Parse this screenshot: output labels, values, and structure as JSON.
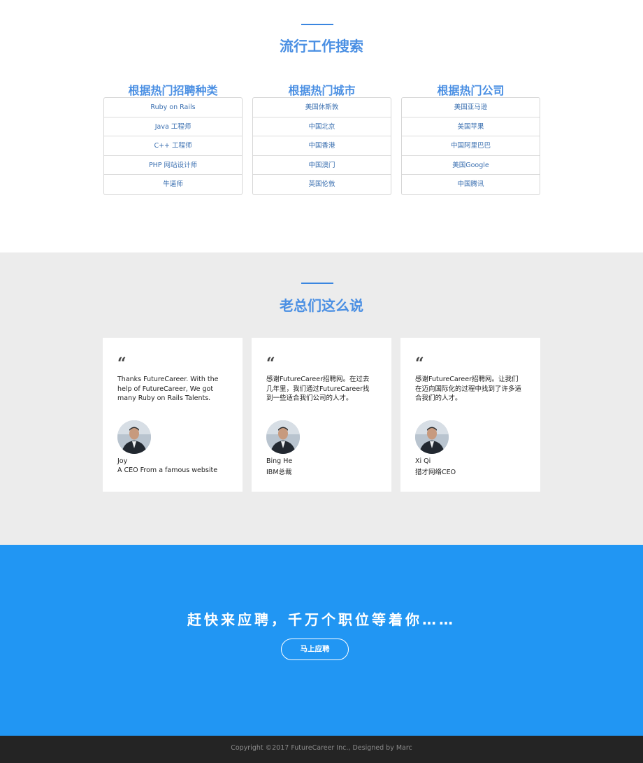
{
  "popular": {
    "title": "流行工作搜索",
    "columns": [
      {
        "title": "根据热门招聘种类",
        "items": [
          "Ruby on Rails",
          "Java 工程师",
          "C++ 工程师",
          "PHP 网站设计师",
          "牛逼师"
        ]
      },
      {
        "title": "根据热门城市",
        "items": [
          "美国休斯敦",
          "中国北京",
          "中国香港",
          "中国澳门",
          "英国伦敦"
        ]
      },
      {
        "title": "根据热门公司",
        "items": [
          "美国亚马逊",
          "美国苹果",
          "中国阿里巴巴",
          "美国Google",
          "中国腾讯"
        ]
      }
    ]
  },
  "ceo": {
    "title": "老总们这么说",
    "quote_glyph": "“",
    "cards": [
      {
        "text": "Thanks FutureCareer. With the help of FutureCareer, We got many Ruby on Rails Talents.",
        "name": "Joy",
        "role": "A CEO From a famous website"
      },
      {
        "text": "感谢FutureCareer招聘网。在过去几年里，我们通过FutureCareer找到一些适合我们公司的人才。",
        "name": "Bing He",
        "role": "IBM总裁"
      },
      {
        "text": "感谢FutureCareer招聘网。让我们在迈向国际化的过程中找到了许多适合我们的人才。",
        "name": "Xi Qi",
        "role": "猎才网络CEO"
      }
    ]
  },
  "cta": {
    "headline": "赶快来应聘，千万个职位等着你……",
    "button_label": "马上应聘"
  },
  "footer": {
    "copyright": "Copyright ©2017 FutureCareer Inc., Designed by Marc"
  },
  "colors": {
    "accent": "#4a8fe3",
    "cta_background": "#2196f3",
    "footer_background": "#242424",
    "testimonial_background": "#ececec"
  }
}
